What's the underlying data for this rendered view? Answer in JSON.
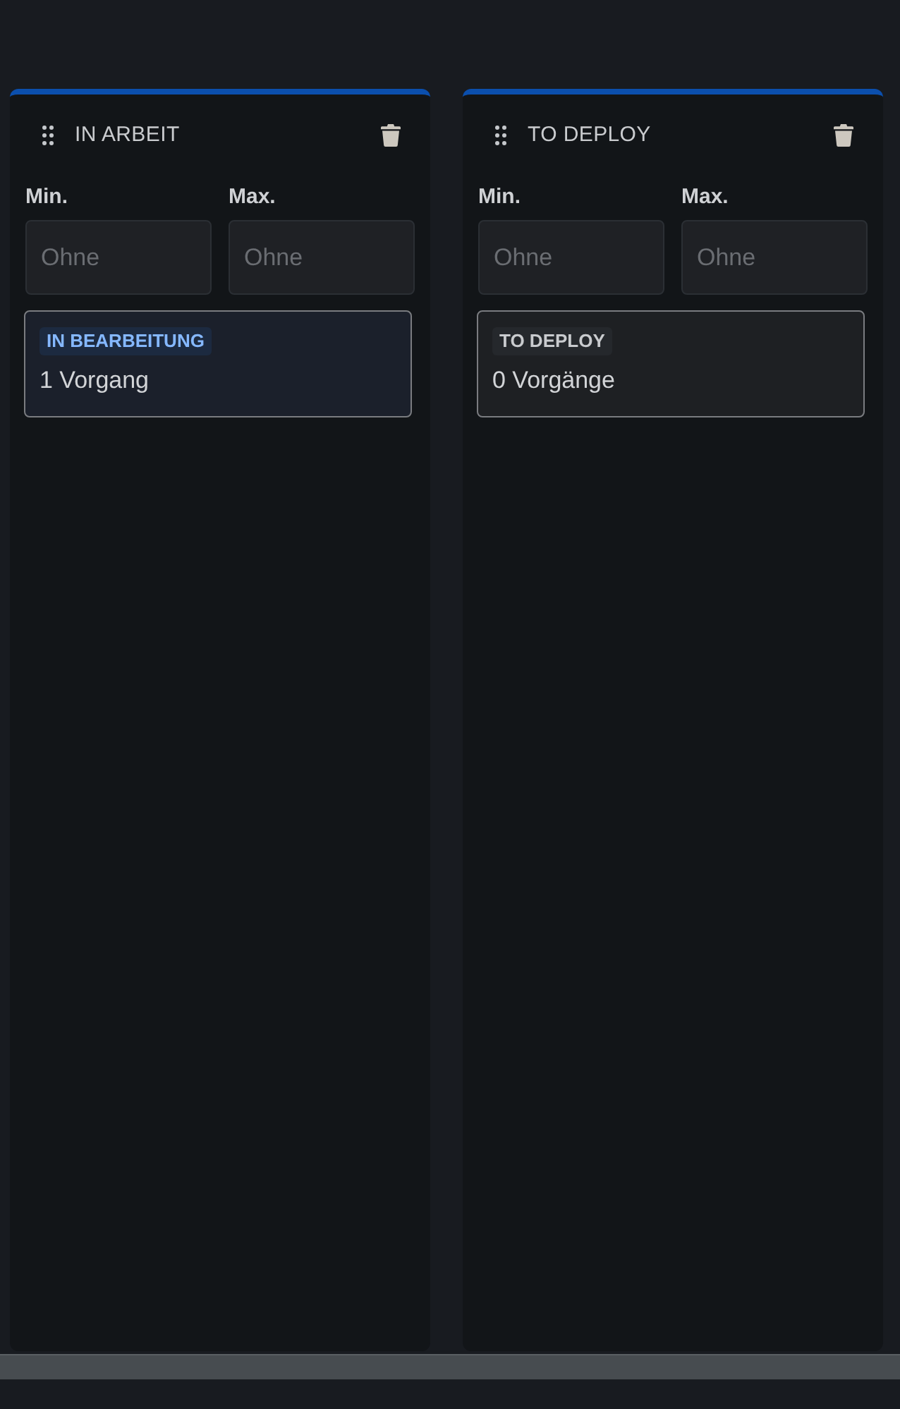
{
  "columns": [
    {
      "title": "IN ARBEIT",
      "limits": [
        {
          "label": "Min.",
          "placeholder": "Ohne"
        },
        {
          "label": "Max.",
          "placeholder": "Ohne"
        }
      ],
      "statuses": [
        {
          "name": "IN BEARBEITUNG",
          "count": "1 Vorgang",
          "kind": "in_progress"
        }
      ]
    },
    {
      "title": "TO DEPLOY",
      "limits": [
        {
          "label": "Min.",
          "placeholder": "Ohne"
        },
        {
          "label": "Max.",
          "placeholder": "Ohne"
        }
      ],
      "statuses": [
        {
          "name": "TO DEPLOY",
          "count": "0 Vorgänge",
          "kind": "todo"
        }
      ]
    }
  ]
}
